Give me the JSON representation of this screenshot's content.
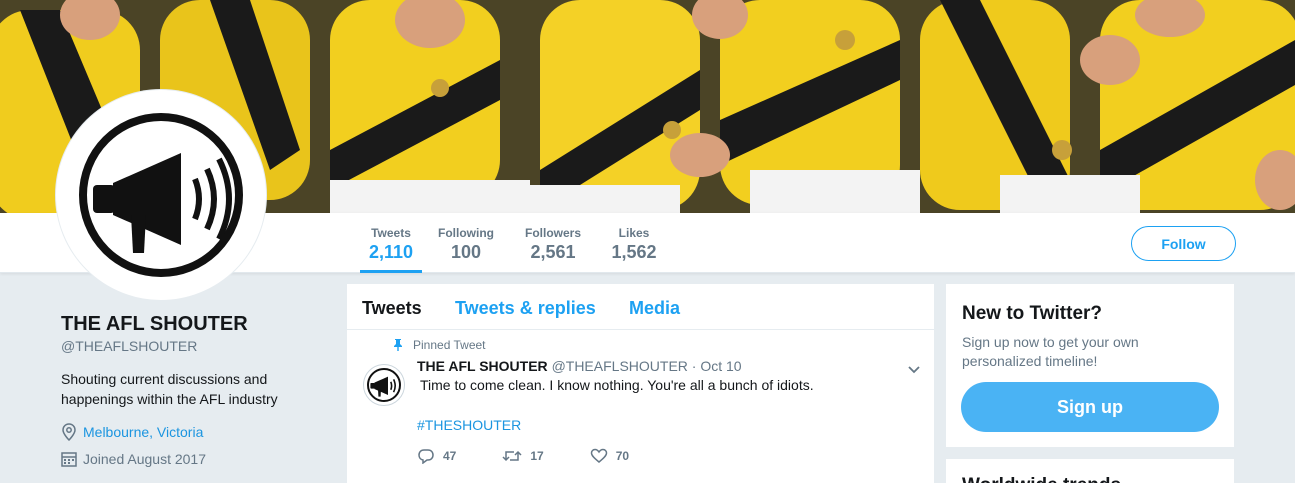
{
  "profile": {
    "name": "THE AFL SHOUTER",
    "handle": "@THEAFLSHOUTER",
    "bio": "Shouting current discussions and happenings within the AFL industry",
    "location": "Melbourne, Victoria",
    "joined": "Joined August 2017"
  },
  "stats": [
    {
      "label": "Tweets",
      "value": "2,110"
    },
    {
      "label": "Following",
      "value": "100"
    },
    {
      "label": "Followers",
      "value": "2,561"
    },
    {
      "label": "Likes",
      "value": "1,562"
    }
  ],
  "follow_label": "Follow",
  "tabs": [
    {
      "label": "Tweets"
    },
    {
      "label": "Tweets & replies"
    },
    {
      "label": "Media"
    }
  ],
  "tweet": {
    "pinned_label": "Pinned Tweet",
    "author": "THE AFL SHOUTER",
    "meta": "@THEAFLSHOUTER · Oct 10",
    "text": "Time to come clean. I know nothing. You're all a bunch of idiots.",
    "hashtag": "#THESHOUTER",
    "replies": "47",
    "retweets": "17",
    "likes": "70"
  },
  "signup_card": {
    "title": "New to Twitter?",
    "body": "Sign up now to get your own personalized timeline!",
    "button": "Sign up"
  },
  "trends_title": "Worldwide trends",
  "colors": {
    "accent": "#1da1f2",
    "jersey_yellow": "#f2cf1f",
    "jersey_black": "#1a1a1a"
  }
}
